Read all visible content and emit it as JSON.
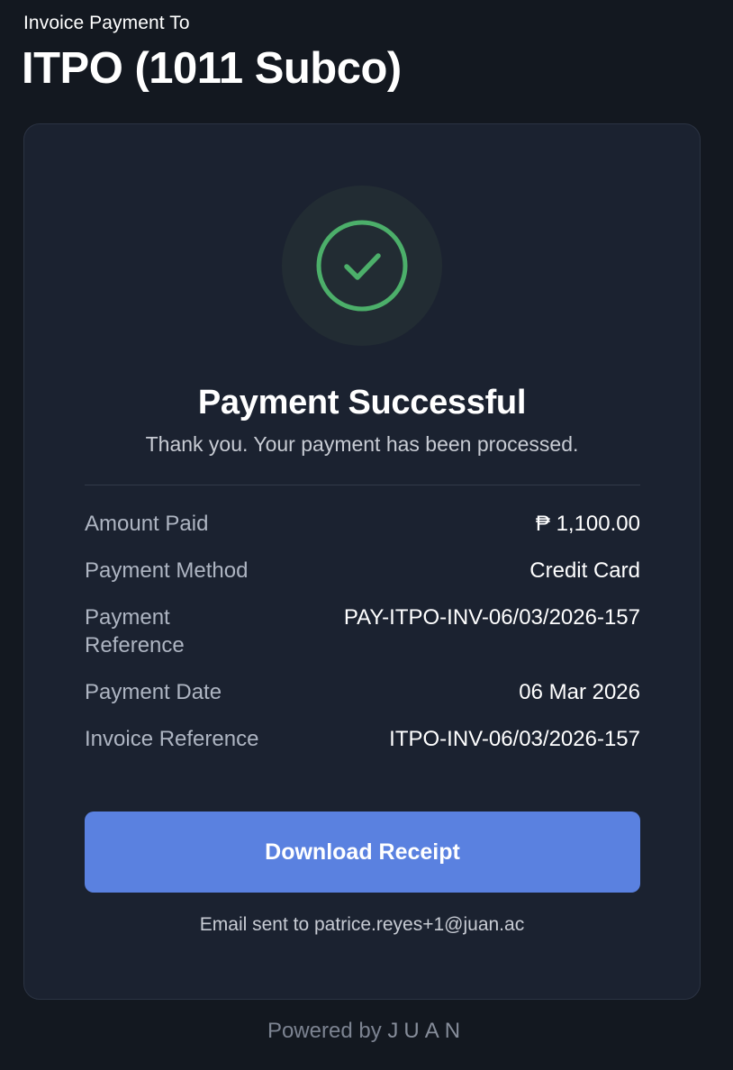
{
  "header": {
    "subtitle": "Invoice Payment To",
    "title": "ITPO (1011 Subco)"
  },
  "status": {
    "icon": "check-circle-icon",
    "icon_color": "#4caf6a",
    "title": "Payment Successful",
    "message": "Thank you. Your payment has been processed."
  },
  "details": [
    {
      "label": "Amount Paid",
      "value": "₱ 1,100.00"
    },
    {
      "label": "Payment Method",
      "value": "Credit Card"
    },
    {
      "label": "Payment Reference",
      "value": "PAY-ITPO-INV-06/03/2026-157"
    },
    {
      "label": "Payment Date",
      "value": "06 Mar 2026"
    },
    {
      "label": "Invoice Reference",
      "value": "ITPO-INV-06/03/2026-157"
    }
  ],
  "actions": {
    "download_label": "Download Receipt",
    "accent_color": "#5a81e0"
  },
  "email_notice": "Email sent to patrice.reyes+1@juan.ac",
  "footer": {
    "powered_by": "Powered by",
    "brand": "JUAN"
  }
}
